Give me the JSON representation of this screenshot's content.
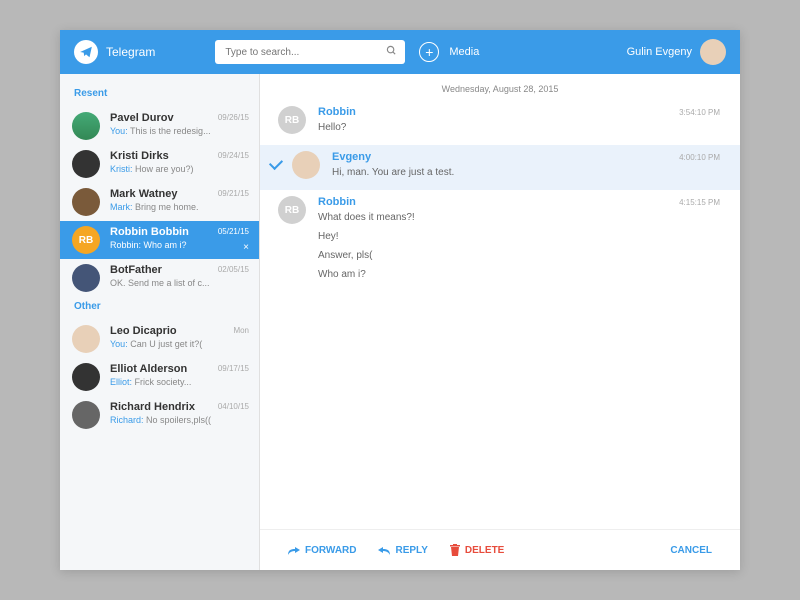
{
  "header": {
    "app_name": "Telegram",
    "search_placeholder": "Type to search...",
    "media_label": "Media",
    "user_name": "Gulin Evgeny"
  },
  "sidebar": {
    "section_resent": "Resent",
    "section_other": "Other",
    "resent": [
      {
        "name": "Pavel Durov",
        "sender": "You",
        "preview": "This is the redesig...",
        "date": "09/26/15",
        "avatar": "av-green"
      },
      {
        "name": "Kristi Dirks",
        "sender": "Kristi",
        "preview": "How are you?)",
        "date": "09/24/15",
        "avatar": "av-dark"
      },
      {
        "name": "Mark Watney",
        "sender": "Mark",
        "preview": "Bring me home.",
        "date": "09/21/15",
        "avatar": "av-brown"
      },
      {
        "name": "Robbin Bobbin",
        "sender": "Robbin",
        "preview": "Who am i?",
        "date": "05/21/15",
        "avatar": "initials",
        "initials": "RB"
      },
      {
        "name": "BotFather",
        "sender": "",
        "preview": "OK. Send me a list of c...",
        "date": "02/05/15",
        "avatar": "av-blue"
      }
    ],
    "other": [
      {
        "name": "Leo Dicaprio",
        "sender": "You",
        "preview": "Can U just get it?(",
        "date": "Mon",
        "avatar": "av-face"
      },
      {
        "name": "Elliot Alderson",
        "sender": "Elliot",
        "preview": "Frick society...",
        "date": "09/17/15",
        "avatar": "av-dark"
      },
      {
        "name": "Richard Hendrix",
        "sender": "Richard",
        "preview": "No spoilers,pls((",
        "date": "04/10/15",
        "avatar": "av-gray"
      }
    ]
  },
  "chat": {
    "date_header": "Wednesday, August 28, 2015",
    "messages": [
      {
        "name": "Robbin",
        "lines": [
          "Hello?"
        ],
        "time": "3:54:10 PM",
        "avatar": "initials",
        "initials": "RB",
        "selected": false
      },
      {
        "name": "Evgeny",
        "lines": [
          "Hi, man. You are just a test."
        ],
        "time": "4:00:10 PM",
        "avatar": "av-face",
        "selected": true
      },
      {
        "name": "Robbin",
        "lines": [
          "What does it means?!",
          "Hey!",
          "Answer, pls(",
          "Who am i?"
        ],
        "time": "4:15:15 PM",
        "avatar": "initials",
        "initials": "RB",
        "selected": false
      }
    ]
  },
  "actions": {
    "forward": "FORWARD",
    "reply": "REPLY",
    "delete": "DELETE",
    "cancel": "CANCEL"
  }
}
